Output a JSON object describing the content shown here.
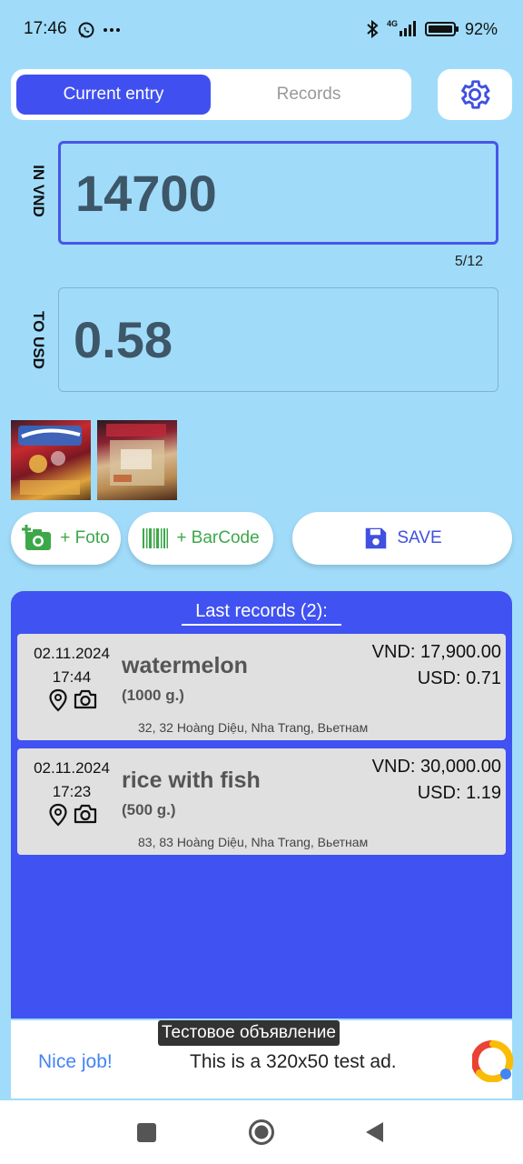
{
  "status_bar": {
    "time": "17:46",
    "network": "4G",
    "battery": "92%",
    "icons": [
      "whatsapp-icon",
      "more-icon",
      "bluetooth-icon",
      "signal-icon",
      "battery-icon"
    ]
  },
  "tabs": [
    {
      "label": "Current entry",
      "active": true
    },
    {
      "label": "Records",
      "active": false
    }
  ],
  "settings": {
    "icon": "gear-icon"
  },
  "vnd_field": {
    "label": "IN VND",
    "value": "14700",
    "counter": "5/12"
  },
  "usd_field": {
    "label": "TO USD",
    "value": "0.58"
  },
  "photos": [
    {
      "icon": "photo-thumbnail"
    },
    {
      "icon": "photo-thumbnail"
    }
  ],
  "buttons": {
    "foto": "+ Foto",
    "barcode": "+ BarCode",
    "save": "SAVE"
  },
  "records": {
    "title": "Last records (2):",
    "items": [
      {
        "date": "02.11.2024",
        "time": "17:44",
        "name": "watermelon",
        "weight": "(1000 g.)",
        "vnd": "VND: 17,900.00",
        "usd": "USD: 0.71",
        "address": "32, 32 Hoàng Diệu, Nha Trang, Вьетнам"
      },
      {
        "date": "02.11.2024",
        "time": "17:23",
        "name": "rice with fish",
        "weight": "(500 g.)",
        "vnd": "VND: 30,000.00",
        "usd": "USD: 1.19",
        "address": "83, 83 Hoàng Diệu, Nha Trang, Вьетнам"
      }
    ]
  },
  "ad": {
    "tag": "Тестовое объявление",
    "nice": "Nice job!",
    "text": "This is a 320x50 test ad."
  },
  "colors": {
    "background": "#a0dcfa",
    "accent": "#4050f0",
    "green": "#3da84a"
  }
}
